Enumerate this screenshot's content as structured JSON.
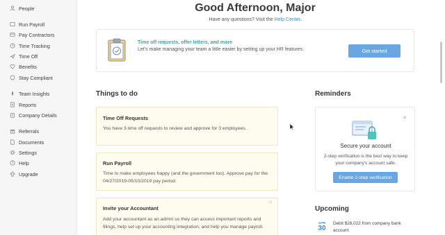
{
  "sidebar": {
    "items": [
      {
        "label": "People",
        "icon": "people-icon"
      },
      {
        "label": "Run Payroll",
        "icon": "payroll-icon"
      },
      {
        "label": "Pay Contractors",
        "icon": "contractors-icon"
      },
      {
        "label": "Time Tracking",
        "icon": "clock-icon"
      },
      {
        "label": "Time Off",
        "icon": "plane-icon"
      },
      {
        "label": "Benefits",
        "icon": "heart-icon"
      },
      {
        "label": "Stay Compliant",
        "icon": "shield-icon"
      },
      {
        "label": "Team Insights",
        "icon": "insights-icon"
      },
      {
        "label": "Reports",
        "icon": "reports-icon"
      },
      {
        "label": "Company Details",
        "icon": "company-icon"
      },
      {
        "label": "Referrals",
        "icon": "gift-icon"
      },
      {
        "label": "Documents",
        "icon": "document-icon"
      },
      {
        "label": "Settings",
        "icon": "gear-icon"
      },
      {
        "label": "Help",
        "icon": "help-icon"
      },
      {
        "label": "Upgrade",
        "icon": "upgrade-icon"
      }
    ]
  },
  "header": {
    "greeting": "Good Afternoon, Major",
    "questions_prefix": "Have any questions? Visit the ",
    "help_center_link": "Help Center",
    "questions_suffix": "."
  },
  "hr_banner": {
    "title": "Time off requests, offer letters, and more",
    "subtitle": "Let's make managing your team a little easier by setting up your HR features.",
    "button_label": "Get started"
  },
  "things_to_do": {
    "title": "Things to do",
    "items": [
      {
        "title": "Time Off Requests",
        "body": "You have 3 time off requests to review and approve for 3 employees."
      },
      {
        "title": "Run Payroll",
        "body": "Time to make employees happy (and the government too). Approve pay for the 04/27/2019-05/10/2019 pay period."
      },
      {
        "title": "Invite your Accountant",
        "body": "Add your accountant as an admin so they can access important reports and filings, help set up your accounting integration, and help you manage payroll."
      }
    ]
  },
  "reminders": {
    "title": "Reminders",
    "card_title": "Secure your account",
    "card_text": "2-step verification is the best way to keep your company's account safe.",
    "button_label": "Enable 2-step verification"
  },
  "upcoming": {
    "title": "Upcoming",
    "month": "APR",
    "day": "30",
    "text": "Debit $28,022 from company bank account"
  },
  "colors": {
    "accent_blue": "#69a6e2",
    "teal": "#3aa9a6",
    "todo_bg": "#fdfcef"
  }
}
